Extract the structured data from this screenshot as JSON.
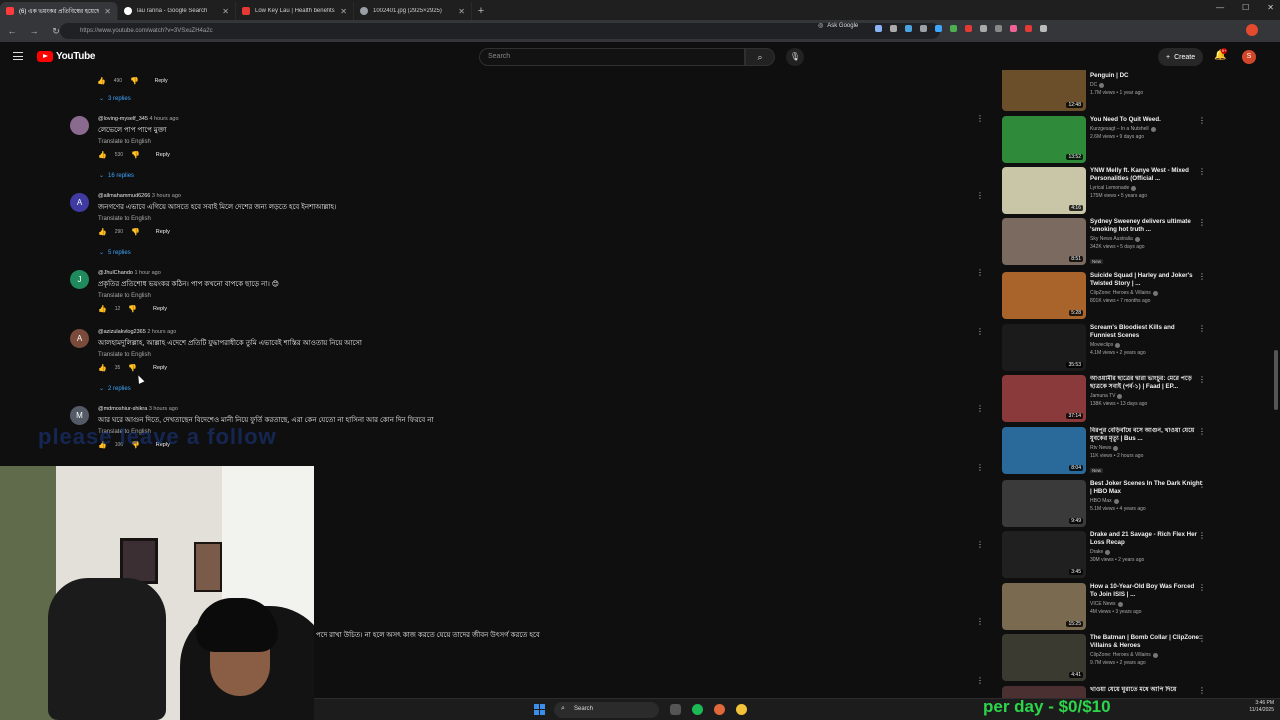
{
  "browser": {
    "tabs": [
      {
        "title": "(6) এক ভয়ংকর প্রতিবিম্বের হয়েছে",
        "color": "#ff3b3b",
        "active": true
      },
      {
        "title": "lau ranna - Google Search",
        "color": "#ffffff"
      },
      {
        "title": "Low Key Lau | Health benefits o",
        "color": "#e53935"
      },
      {
        "title": "1002401.jpg (2925×2925)",
        "color": "#9aa0a6"
      }
    ],
    "url": "https://www.youtube.com/watch?v=3VSxuZH4a2c",
    "ask_google": "Ask Google"
  },
  "youtube": {
    "logo_text": "YouTube",
    "search_placeholder": "Search",
    "create_label": "Create",
    "notification_count": "9+",
    "avatar_letter": "S"
  },
  "comments": {
    "top_actions": {
      "likes": "490",
      "reply_label": "Reply"
    },
    "reply_toggles": [
      "3 replies",
      "16 replies",
      "5 replies",
      "2 replies"
    ],
    "items": [
      {
        "author": "@loving-myself_345",
        "time": "4 hours ago",
        "text": "লেভেলে পাপ পাপে মুক্তা",
        "translate": "Translate to English",
        "likes": "530",
        "reply": "Reply",
        "avatar": "",
        "color": "#8a6a8f"
      },
      {
        "author": "@allmahammud6266",
        "time": "3 hours ago",
        "text": "জনগণের এভাবে এগিয়ে আসতে হবে সবাই মিলে দেশের জন্য লড়তে হবে ইনশাআল্লাহ।",
        "translate": "Translate to English",
        "likes": "290",
        "reply": "Reply",
        "avatar": "A",
        "color": "#3f3ba3"
      },
      {
        "author": "@JhulChando",
        "time": "1 hour ago",
        "text": "প্রকৃতির প্রতিশোধ ভয়ংকর কঠিন। পাপ কখনো বাপকে ছাড়ে না। 😊",
        "translate": "Translate to English",
        "likes": "12",
        "reply": "Reply",
        "avatar": "J",
        "color": "#1f8a5c"
      },
      {
        "author": "@azizulakvlog2365",
        "time": "2 hours ago",
        "text": "আলহামদুলিল্লাহ, আল্লাহ এদেশে প্রতিটি যুদ্ধাপরাধীকে তুমি এভাবেই শাস্তির আওতায় নিয়ে আসো",
        "translate": "Translate to English",
        "likes": "35",
        "reply": "Reply",
        "avatar": "A",
        "color": "#7a4a3a"
      },
      {
        "author": "@mdmoshiur-shikra",
        "time": "3 hours ago",
        "text": "আর ঘরে আগুন দিতে, দেখতাছেন বিদেশেও মানী নিয়ে ফুর্তি করতাছে, এরা কেন যেতো না হাসিনা আর কোন দিন ফিরবে না",
        "translate": "Translate to English",
        "likes": "106",
        "reply": "Reply",
        "avatar": "M",
        "color": "#555b66"
      }
    ]
  },
  "overlay": {
    "watermark": "please leave a follow",
    "subtitle": "পদে রাখা উচিত। না হলে অসৎ কাজ করতে যেয়ে তাদের জীবন উৎসর্গ করতে হবে",
    "promo": "per day - $0/$10"
  },
  "sidebar": {
    "videos": [
      {
        "title": "The Batman: Scenes with The Penguin | DC",
        "channel": "DC",
        "stats": "1.7M views • 1 year ago",
        "duration": "12:48",
        "thumb": "#6a4f2a",
        "badge": ""
      },
      {
        "title": "You Need To Quit Weed.",
        "channel": "Kurzgesagt – In a Nutshell",
        "stats": "2.6M views • 9 days ago",
        "duration": "13:52",
        "thumb": "#2f8a3a",
        "badge": ""
      },
      {
        "title": "YNW Melly ft. Kanye West - Mixed Personalities (Official ...",
        "channel": "Lyrical Lemonade",
        "stats": "175M views • 5 years ago",
        "duration": "4:16",
        "thumb": "#c9c6a8",
        "badge": ""
      },
      {
        "title": "Sydney Sweeney delivers ultimate 'smoking hot truth ...",
        "channel": "Sky News Australia",
        "stats": "342K views • 5 days ago",
        "duration": "8:51",
        "thumb": "#7a6a60",
        "badge": "New"
      },
      {
        "title": "Suicide Squad | Harley and Joker's Twisted Story | ...",
        "channel": "ClipZone: Heroes & Villains",
        "stats": "801K views • 7 months ago",
        "duration": "5:28",
        "thumb": "#a8642a",
        "badge": ""
      },
      {
        "title": "Scream's Bloodiest Kills and Funniest Scenes",
        "channel": "Movieclips",
        "stats": "4.1M views • 2 years ago",
        "duration": "35:53",
        "thumb": "#1b1b1b",
        "badge": ""
      },
      {
        "title": "আওয়ামীর ছাত্রের দ্বারা ভাংচুর: মেরে পড়ে ছাত্রকে সবাই (পর্ব-১) | Faad | EP...",
        "channel": "Jamuna TV",
        "stats": "138K views • 13 days ago",
        "duration": "37:14",
        "thumb": "#8a3a3a",
        "badge": ""
      },
      {
        "title": "বিরপুর বেড়িবাঁধে বসে আগুন, খাওয়া যেয়ে যুবকের মৃত্যু | Bus ...",
        "channel": "Rtv News",
        "stats": "11K views • 2 hours ago",
        "duration": "8:04",
        "thumb": "#2a6a9a",
        "badge": "New"
      },
      {
        "title": "Best Joker Scenes In The Dark Knight | HBO Max",
        "channel": "HBO Max",
        "stats": "5.1M views • 4 years ago",
        "duration": "9:49",
        "thumb": "#3a3a3a",
        "badge": ""
      },
      {
        "title": "Drake and 21 Savage - Rich Flex Her Loss Recap",
        "channel": "Drake",
        "stats": "30M views • 2 years ago",
        "duration": "3:45",
        "thumb": "#202020",
        "badge": ""
      },
      {
        "title": "How a 10-Year-Old Boy Was Forced To Join ISIS | ...",
        "channel": "VICE News",
        "stats": "4M views • 3 years ago",
        "duration": "15:25",
        "thumb": "#7a6a50",
        "badge": ""
      },
      {
        "title": "The Batman | Bomb Collar | ClipZone: Villains & Heroes",
        "channel": "ClipZone: Heroes & Villains",
        "stats": "9.7M views • 2 years ago",
        "duration": "4:41",
        "thumb": "#3a3a30",
        "badge": ""
      },
      {
        "title": "খাওয়া যেয়ে ঘুরাতে মধে আপি দিয়ে",
        "channel": "",
        "stats": "",
        "duration": "",
        "thumb": "#4a3030",
        "badge": ""
      }
    ]
  },
  "taskbar": {
    "search_label": "Search",
    "time": "3:46 PM",
    "date": "11/14/2025"
  }
}
